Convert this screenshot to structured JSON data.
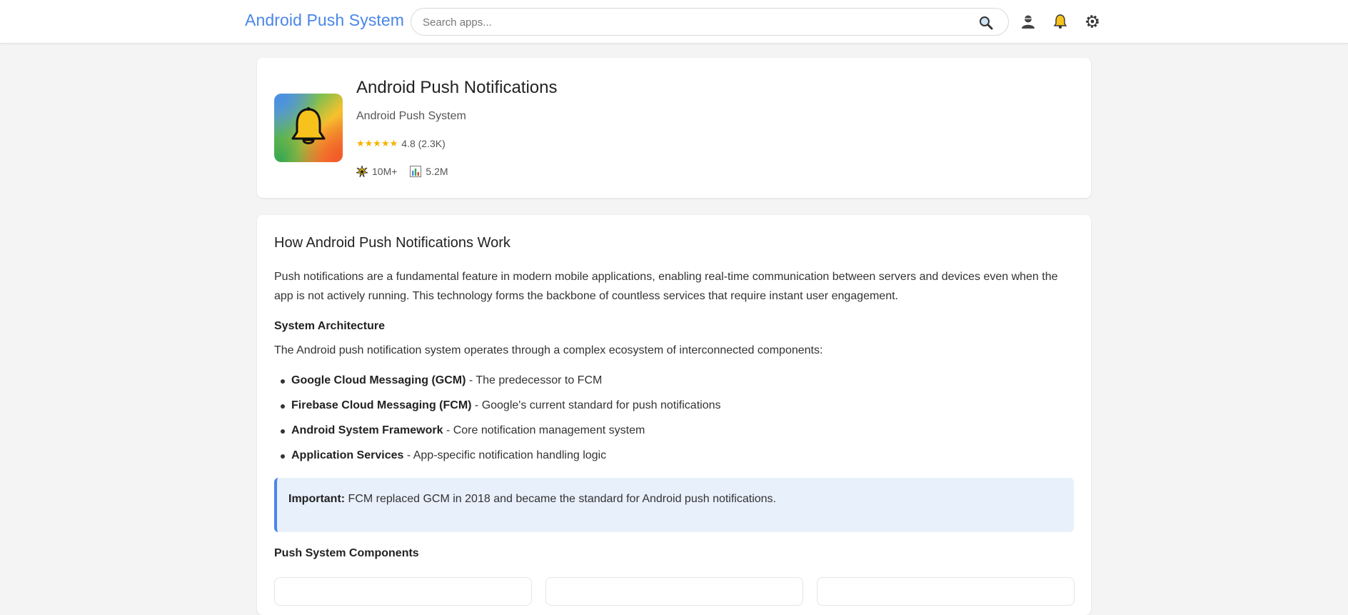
{
  "header": {
    "brand": "Android Push System",
    "search_placeholder": "Search apps...",
    "icons": [
      "search-icon",
      "user-icon",
      "bell-icon",
      "gear-icon"
    ]
  },
  "app": {
    "title": "Android Push Notifications",
    "developer": "Android Push System",
    "stars": "★★★★★",
    "rating": "4.8 (2.3K)",
    "downloads": "10M+",
    "active_users": "5.2M",
    "icon": "bell-icon"
  },
  "article": {
    "heading": "How Android Push Notifications Work",
    "intro": "Push notifications are a fundamental feature in modern mobile applications, enabling real-time communication between servers and devices even when the app is not actively running. This technology forms the backbone of countless services that require instant user engagement.",
    "architecture_heading": "System Architecture",
    "architecture_intro": "The Android push notification system operates through a complex ecosystem of interconnected components:",
    "components": [
      {
        "name": "Google Cloud Messaging (GCM)",
        "desc": " - The predecessor to FCM"
      },
      {
        "name": "Firebase Cloud Messaging (FCM)",
        "desc": " - Google's current standard for push notifications"
      },
      {
        "name": "Android System Framework",
        "desc": " - Core notification management system"
      },
      {
        "name": "Application Services",
        "desc": " - App-specific notification handling logic"
      }
    ],
    "callout_label": "Important:",
    "callout_text": " FCM replaced GCM in 2018 and became the standard for Android push notifications.",
    "components_heading": "Push System Components"
  },
  "colors": {
    "brand": "#4a86e8",
    "star": "#f5b301",
    "callout_bg": "#e8f0fc",
    "bell": "#f7c21b"
  }
}
